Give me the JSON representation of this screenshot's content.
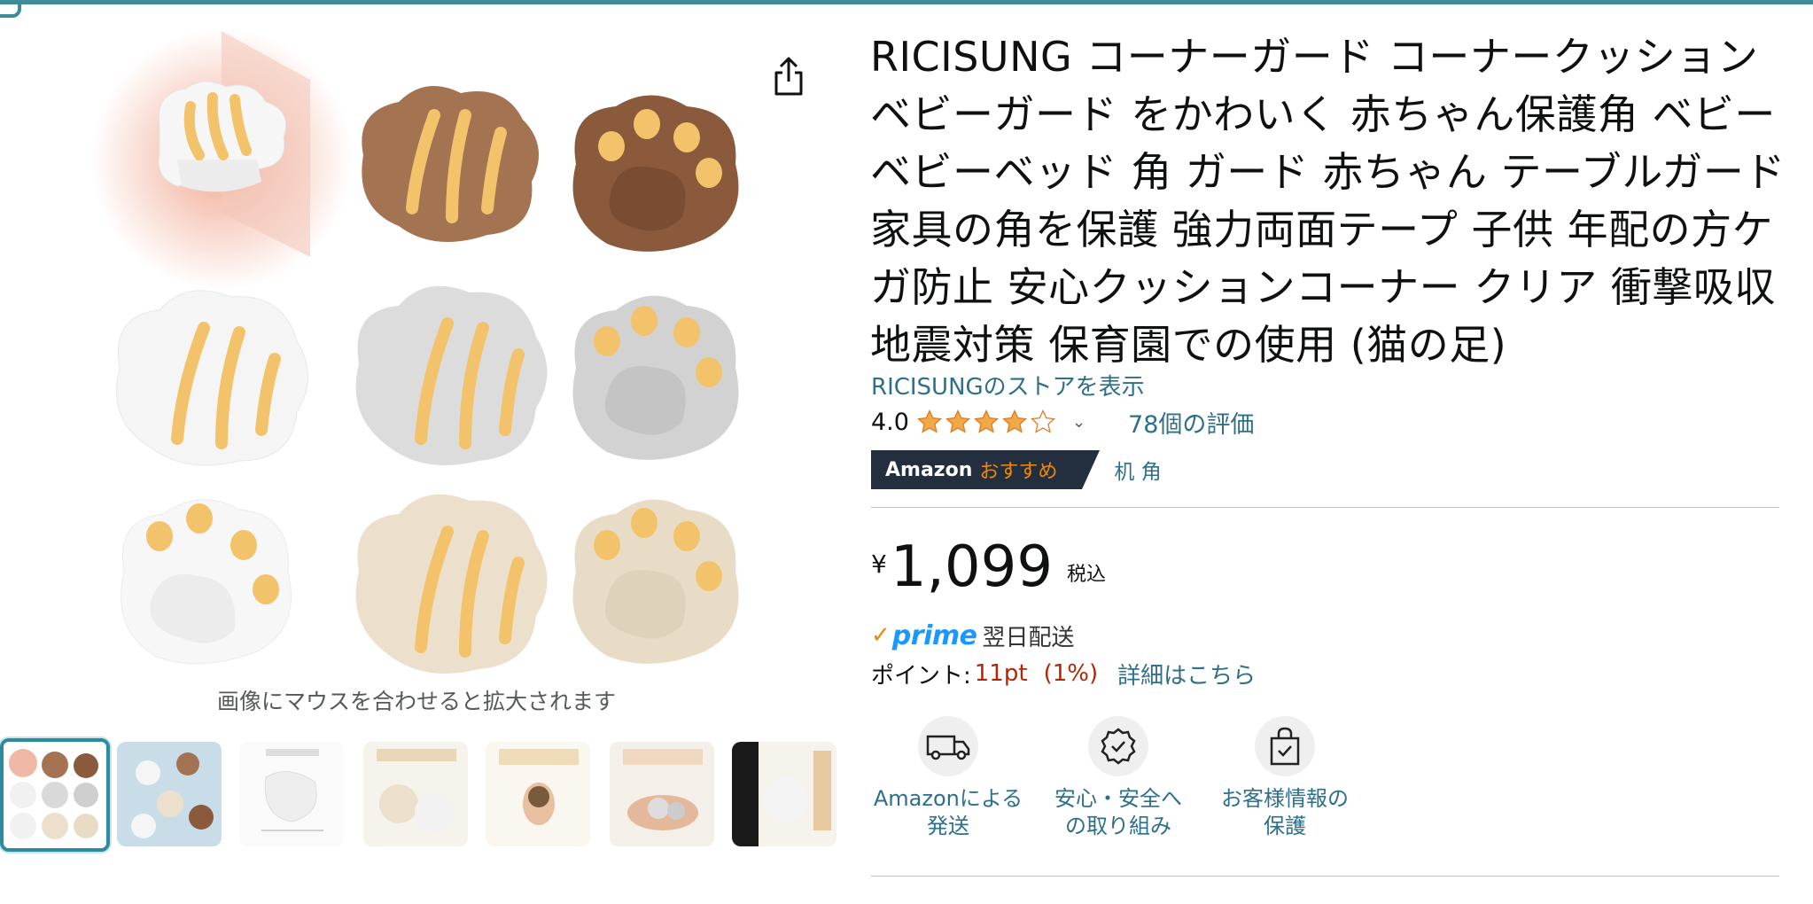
{
  "product": {
    "title": "RICISUNG コーナーガード コーナークッション ベビーガード をかわいく 赤ちゃん保護角 ベビーベビーベッド 角 ガード 赤ちゃん テーブルガード 家具の角を保護 強力両面テープ 子供 年配の方ケガ防止 安心クッションコーナー クリア 衝撃吸収 地震対策 保育園での使用 (猫の足)",
    "store_link": "RICISUNGのストアを表示",
    "rating": "4.0",
    "stars": 4,
    "reviews": "78個の評価",
    "badge_prefix": "Amazon",
    "badge_accent": "おすすめ",
    "badge_link": "机 角",
    "currency": "¥",
    "price": "1,099",
    "tax_label": "税込",
    "prime_label": "prime",
    "delivery": "翌日配送",
    "points_label": "ポイント:",
    "points_value": "11pt",
    "points_percent": "(1%)",
    "points_link": "詳細はこちら"
  },
  "image": {
    "hover_hint": "画像にマウスを合わせると拡大されます"
  },
  "features": [
    {
      "line1": "Amazonによる",
      "line2": "発送",
      "icon": "delivery-van-icon"
    },
    {
      "line1": "安心・安全へ",
      "line2": "の取り組み",
      "icon": "safety-badge-icon"
    },
    {
      "line1": "お客様情報の",
      "line2": "保護",
      "icon": "secure-bag-icon"
    }
  ],
  "colors": {
    "link": "#2e6f8a",
    "price_red": "#b12704",
    "badge_bg": "#232f3e",
    "badge_accent": "#f08804",
    "star": "#f3a847",
    "prime_blue": "#1a98ff",
    "thumb_border": "#2e8aa0"
  }
}
